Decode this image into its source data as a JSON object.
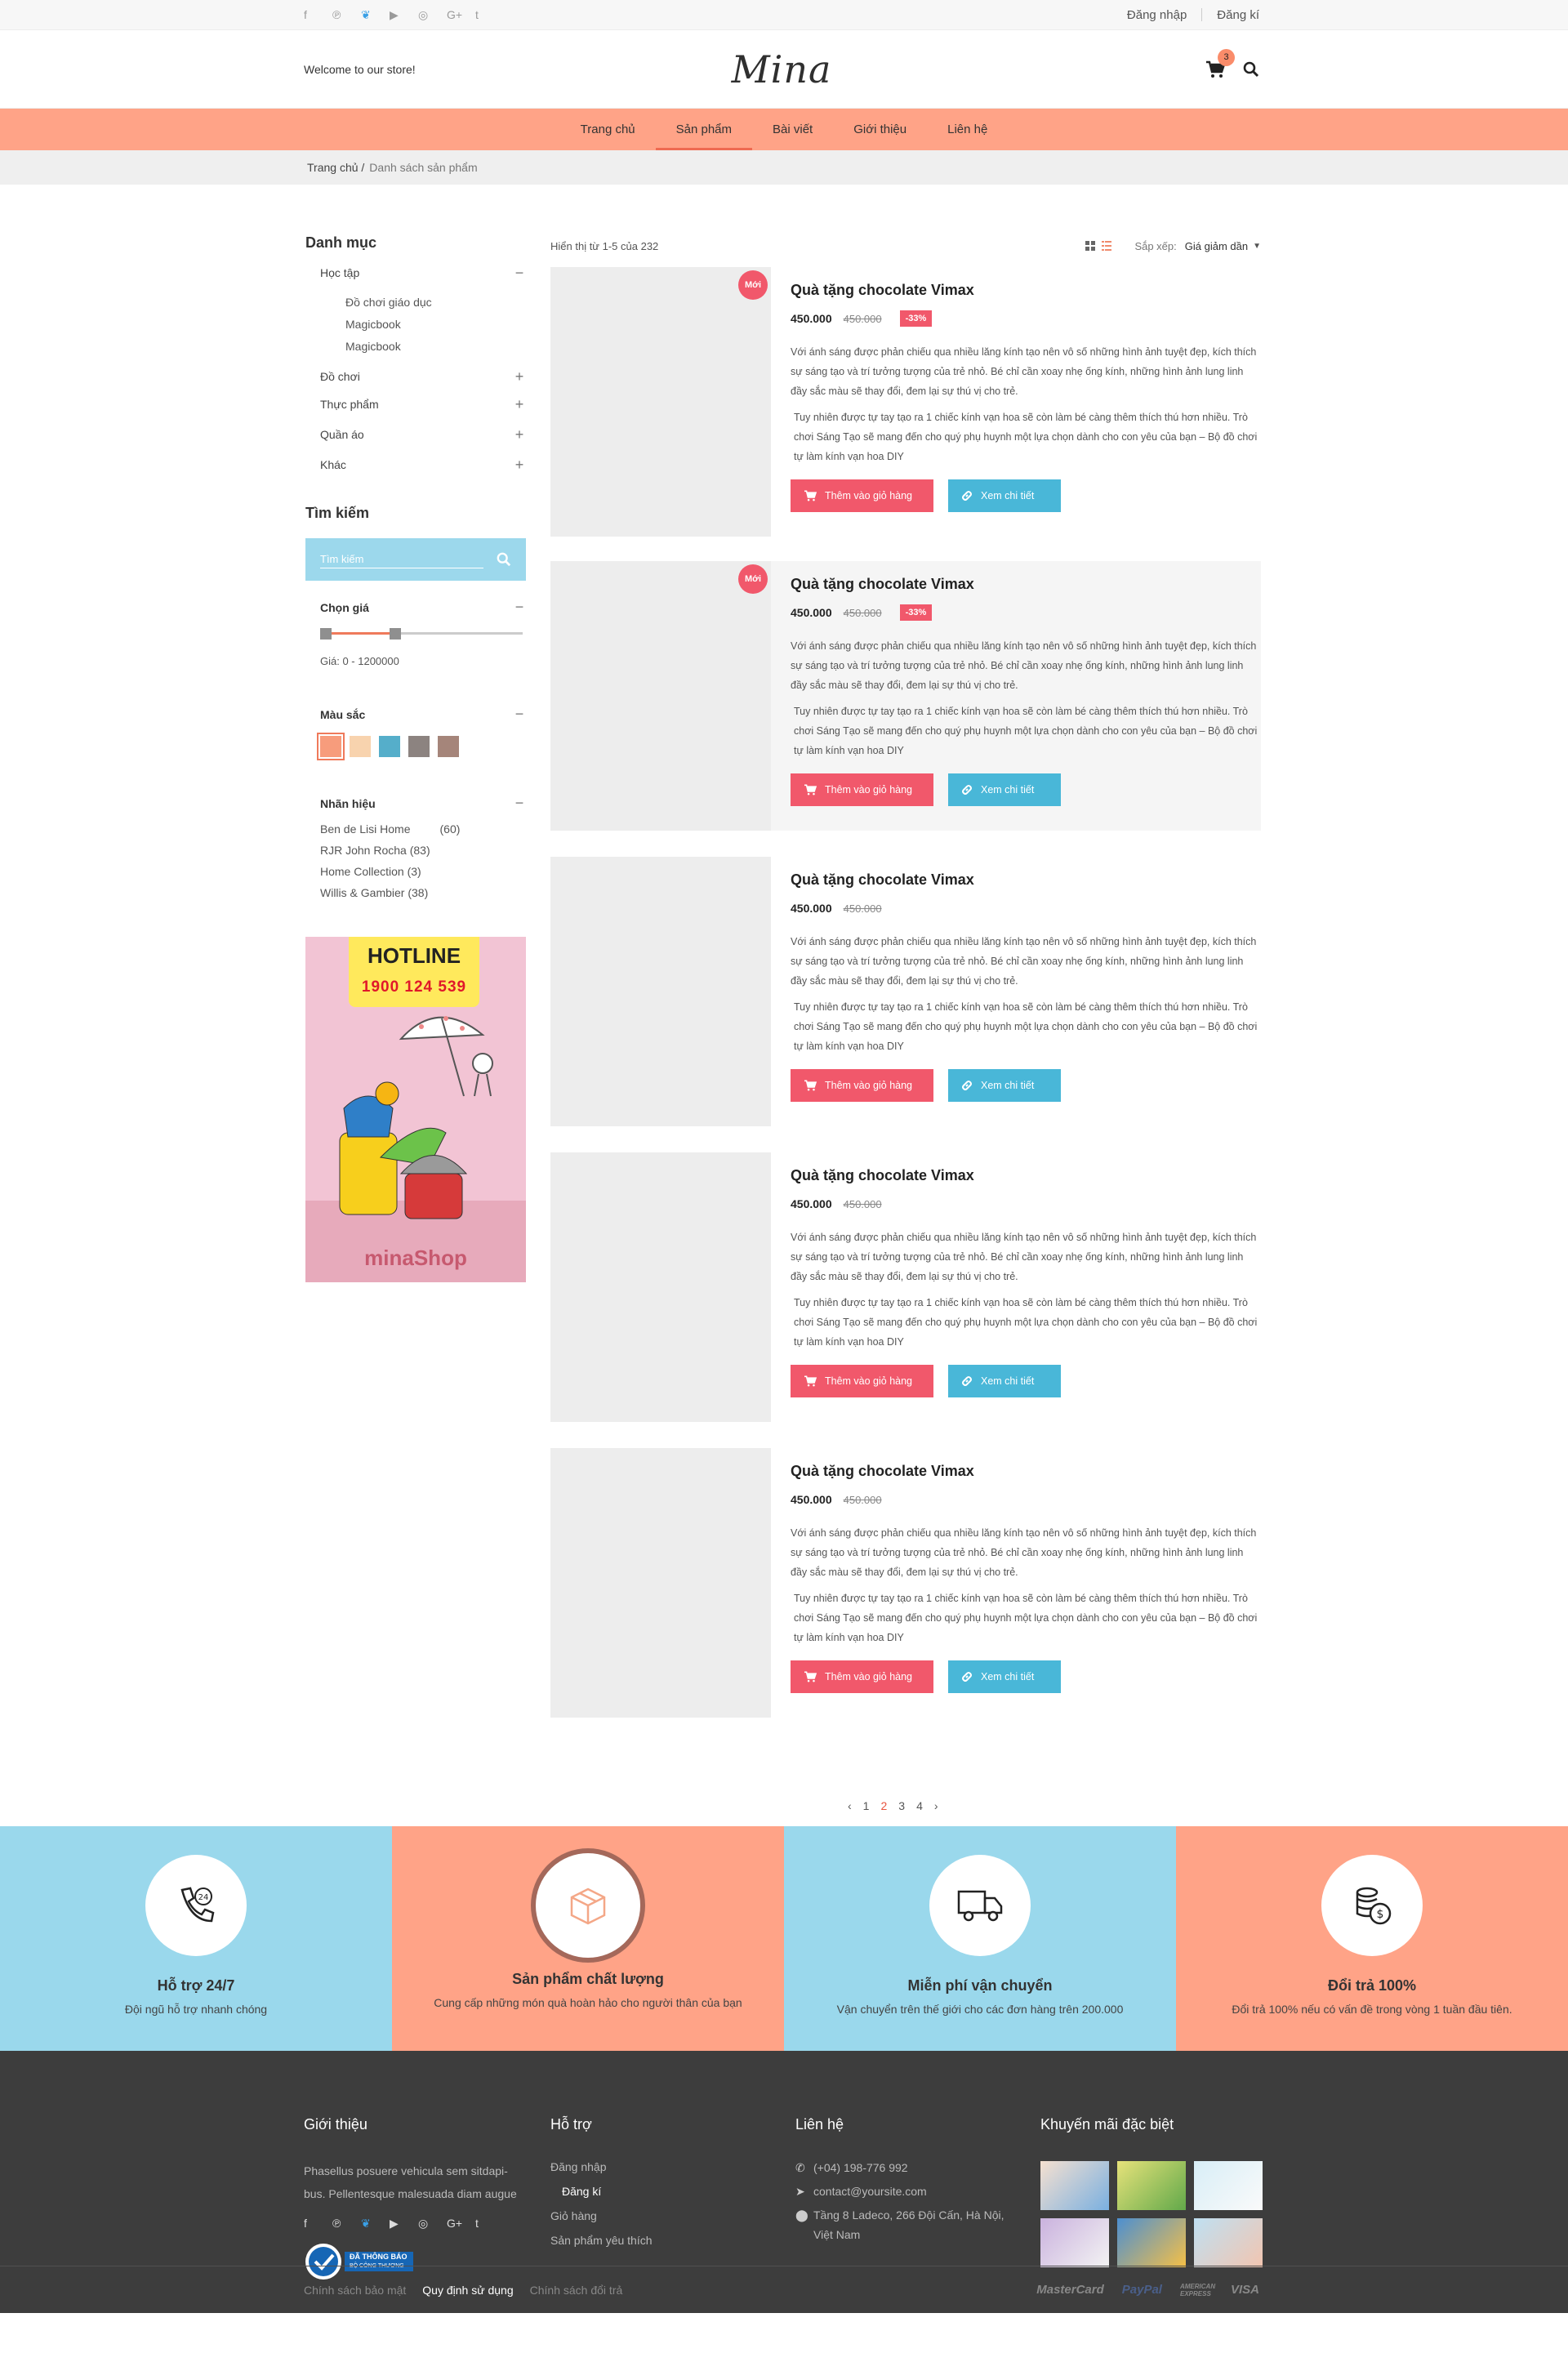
{
  "topbar": {
    "social": [
      "f",
      "p",
      "t",
      "yt",
      "ig",
      "G+",
      "t"
    ],
    "login": "Đăng nhập",
    "register": "Đăng kí"
  },
  "header": {
    "welcome": "Welcome to our store!",
    "logo": "Mina",
    "cart_count": "3"
  },
  "nav": [
    "Trang chủ",
    "Sản phẩm",
    "Bài viết",
    "Giới thiệu",
    "Liên hệ"
  ],
  "breadcrumb": {
    "home": "Trang chủ /",
    "current": "Danh sách sản phẩm"
  },
  "sidebar": {
    "category_title": "Danh mục",
    "categories": [
      {
        "label": "Học tập",
        "sym": "−",
        "children": [
          "Đồ chơi giáo dục",
          "Magicbook",
          "Magicbook"
        ]
      },
      {
        "label": "Đồ chơi",
        "sym": "+"
      },
      {
        "label": "Thực phẩm",
        "sym": "+"
      },
      {
        "label": "Quần áo",
        "sym": "+"
      },
      {
        "label": "Khác",
        "sym": "+"
      }
    ],
    "search_title": "Tìm kiếm",
    "search_placeholder": "Tìm kiếm",
    "price_title": "Chọn giá",
    "price_range": "Giá: 0 - 1200000",
    "price_slider": {
      "min": 0,
      "max": 1200000
    },
    "color_title": "Màu  sắc",
    "colors": [
      "#f79c7c",
      "#f8d3ae",
      "#55aeca",
      "#8c8380",
      "#a5857a"
    ],
    "brand_title": "Nhãn hiệu",
    "brands": [
      {
        "name": "Ben de Lisi Home",
        "count": "(60)"
      },
      {
        "name": "RJR John Rocha (83)",
        "count": ""
      },
      {
        "name": "Home Collection (3)",
        "count": ""
      },
      {
        "name": "Willis & Gambier  (38)",
        "count": ""
      }
    ],
    "banner": {
      "hotline": "HOTLINE",
      "phone": "1900 124 539",
      "shop": "minaShop"
    }
  },
  "listing": {
    "count_text": "Hiển thị từ 1-5 của 232",
    "sort_label": "Sắp xếp:",
    "sort_value": "Giá giảm dần"
  },
  "products": [
    {
      "name": "Quà tặng chocolate Vimax",
      "price": "450.000",
      "old": "450.000",
      "discount": "-33%",
      "badge": "Mới"
    },
    {
      "name": "Quà tặng chocolate Vimax",
      "price": "450.000",
      "old": "450.000",
      "discount": "-33%",
      "badge": "Mới"
    },
    {
      "name": "Quà tặng chocolate Vimax",
      "price": "450.000",
      "old": "450.000",
      "discount": "",
      "badge": ""
    },
    {
      "name": "Quà tặng chocolate Vimax",
      "price": "450.000",
      "old": "450.000",
      "discount": "",
      "badge": ""
    },
    {
      "name": "Quà tặng chocolate Vimax",
      "price": "450.000",
      "old": "450.000",
      "discount": "",
      "badge": ""
    }
  ],
  "product_text": {
    "desc1": "Với ánh sáng được phản chiếu qua nhiều lăng kính tạo nên vô số những hình ảnh tuyệt đẹp, kích thích sự sáng tạo và trí tưởng tượng của trẻ nhỏ. Bé chỉ cần xoay nhẹ ống kính, những hình ảnh lung linh đầy sắc màu sẽ thay đổi, đem lại sự thú vị cho trẻ.",
    "desc2": "Tuy nhiên được tự tay tạo ra 1 chiếc kính vạn hoa sẽ còn làm bé càng thêm thích thú hơn nhiều. Trò chơi Sáng Tạo sẽ mang đến cho quý phụ huynh một lựa chọn dành cho con yêu của bạn – Bộ đồ chơi tự làm kính vạn hoa DIY",
    "add_cart": "Thêm vào giỏ hàng",
    "view": "Xem chi tiết"
  },
  "pagination": {
    "prev": "‹",
    "pages": [
      "1",
      "2",
      "3",
      "4"
    ],
    "current": "2",
    "next": "›"
  },
  "services": [
    {
      "title": "Hỗ trợ 24/7",
      "desc": "Đội ngũ hỗ trợ nhanh chóng",
      "bg": "#9ad8ec"
    },
    {
      "title": "Sản phẩm chất lượng",
      "desc": "Cung cấp những món quà hoàn hảo cho người thân của bạn",
      "bg": "#ffa387"
    },
    {
      "title": "Miễn phí vận chuyển",
      "desc": "Vận chuyển trên thế giới cho các đơn hàng trên  200.000",
      "bg": "#9ad8ec"
    },
    {
      "title": "Đổi trả 100%",
      "desc": "Đổi trả 100% nếu có vấn đề trong vòng 1 tuần đầu tiên.",
      "bg": "#ffa387"
    }
  ],
  "footer": {
    "about_title": "Giới thiệu",
    "about_text": "Phasellus posuere vehicula sem sitdapi-bus. Pellentesque malesuada diam augue",
    "certif_line1": "ĐÃ THÔNG BÁO",
    "certif_line2": "BỘ CÔNG THƯƠNG",
    "support_title": "Hỗ trợ",
    "support_links": [
      "Đăng nhập",
      "Đăng kí",
      "Giỏ hàng",
      "Sản phẩm yêu thích"
    ],
    "contact_title": "Liên hệ",
    "phone": "(+04) 198-776 992",
    "email": "contact@yoursite.com",
    "address": "Tầng 8 Ladeco, 266 Đội Cấn, Hà Nội, Việt Nam",
    "promo_title": "Khuyến mãi đặc biệt",
    "bottom_links": [
      "Chính sách bảo mật",
      "Quy định sử dụng",
      "Chính sách đổi trả"
    ],
    "payments": [
      "MasterCard",
      "PayPal",
      "AMERICAN EXPRESS",
      "VISA"
    ]
  }
}
